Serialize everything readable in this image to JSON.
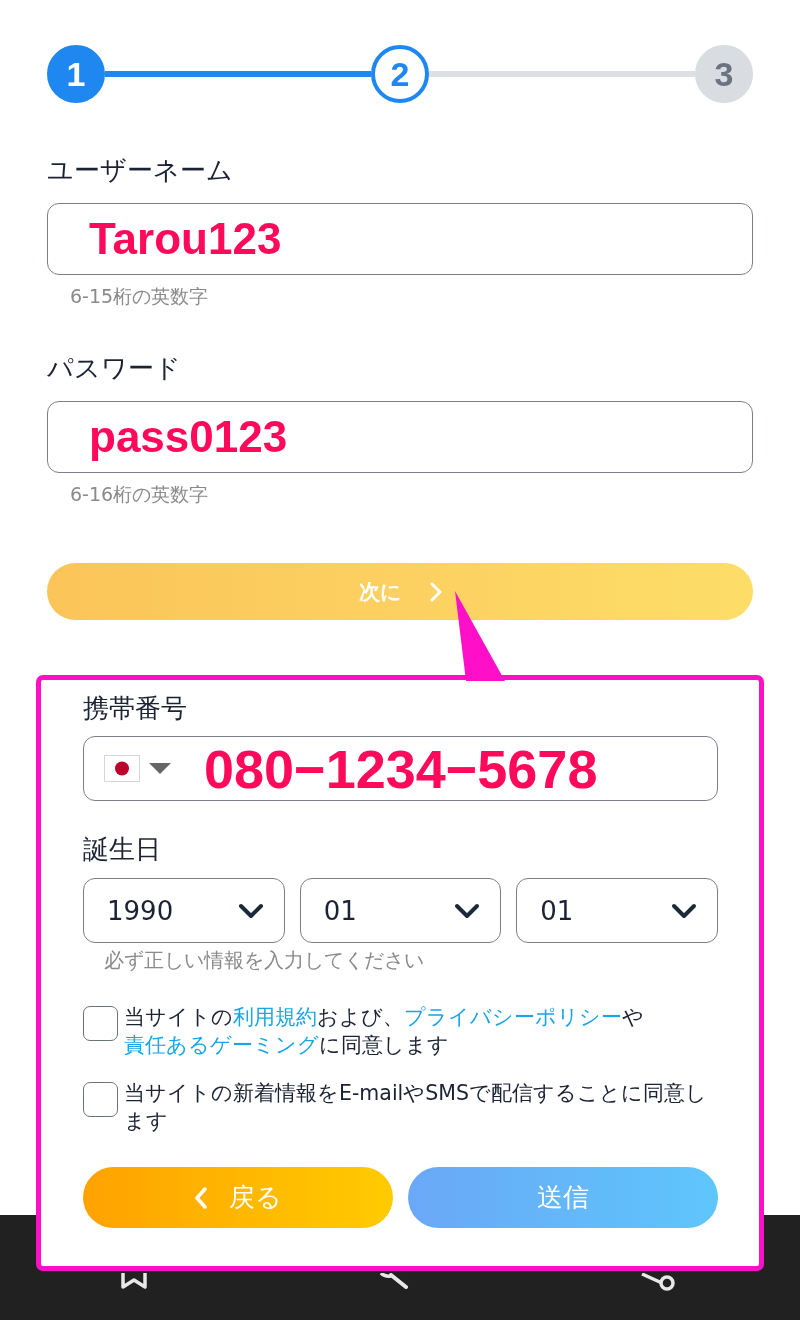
{
  "stepper": {
    "steps": [
      {
        "label": "1",
        "selected": false
      },
      {
        "label": "2",
        "selected": true
      },
      {
        "label": "3",
        "selected": false
      }
    ]
  },
  "account_fields": [
    {
      "label": "ユーザーネーム",
      "value": "Tarou123",
      "hint": "6-15桁の英数字"
    },
    {
      "label": "パスワード",
      "value": "pass0123",
      "hint": "6-16桁の英数字"
    }
  ],
  "next_button": {
    "label": "次に"
  },
  "callout": {
    "phone": {
      "label": "携帯番号",
      "value": "080−1234−5678"
    },
    "birthday": {
      "label": "誕生日",
      "selects": [
        "1990",
        "01",
        "01"
      ],
      "hint": "必ず正しい情報を入力してください"
    },
    "consents": [
      {
        "checked": false,
        "segments": [
          {
            "text": "当サイトの",
            "link": false
          },
          {
            "text": "利用規約",
            "link": true
          },
          {
            "text": "および、",
            "link": false
          },
          {
            "text": "プライバシーポリシー",
            "link": true
          },
          {
            "text": "や",
            "link": false
          },
          {
            "text": "責任あるゲーミング",
            "link": true
          },
          {
            "text": "に同意します",
            "link": false
          }
        ]
      },
      {
        "checked": false,
        "segments": [
          {
            "text": "当サイトの新着情報をE-mailやSMSで配信することに同意します",
            "link": false
          }
        ]
      }
    ],
    "buttons": [
      {
        "label": "戻る",
        "kind": "back"
      },
      {
        "label": "送信",
        "kind": "submit"
      }
    ]
  }
}
